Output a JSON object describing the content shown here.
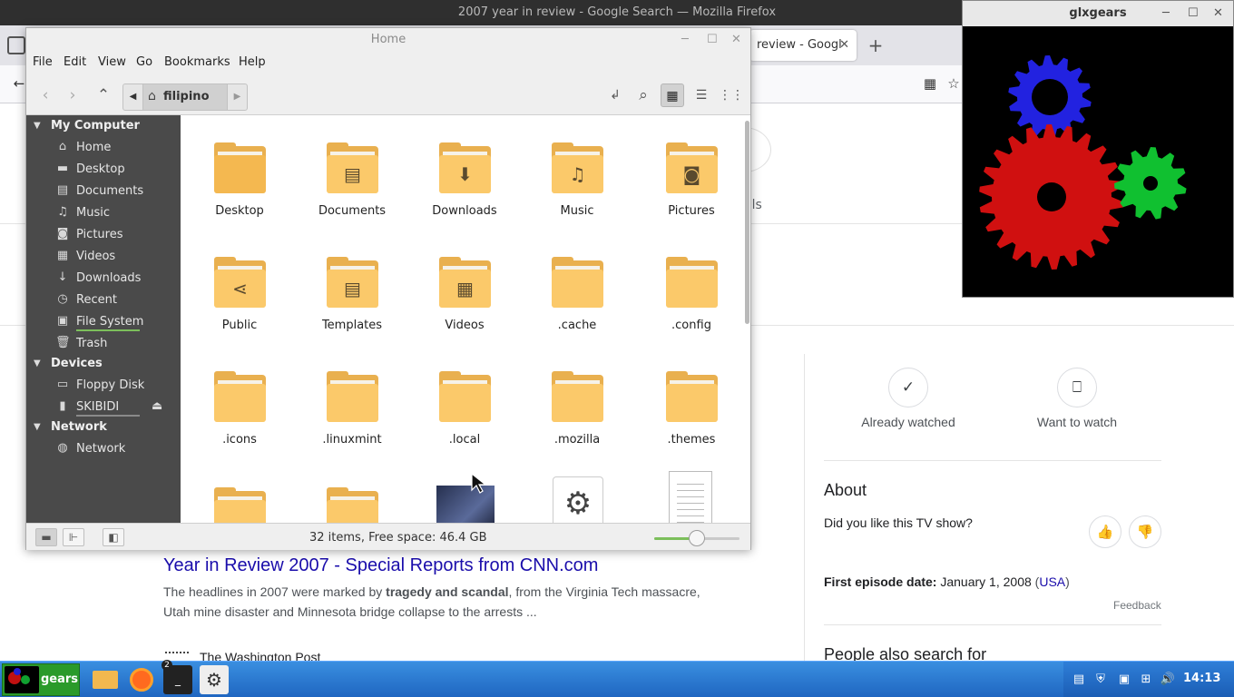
{
  "firefox": {
    "title": "2007 year in review - Google Search — Mozilla Firefox",
    "tab_label": "review - Googl",
    "tab_close": "✕",
    "new_tab": "+",
    "tools_fragment": "ols"
  },
  "google": {
    "result": {
      "title": "Year in Review 2007 - Special Reports from CNN.com",
      "snippet_prefix": "The headlines in 2007 were marked by ",
      "snippet_bold": "tragedy and scandal",
      "snippet_suffix": ", from the Virginia Tech massacre, Utah mine disaster and Minnesota bridge collapse to the arrests ...",
      "next_source": "The Washington Post"
    },
    "knowledge_panel": {
      "already_watched": "Already watched",
      "want_to_watch": "Want to watch",
      "about": "About",
      "question": "Did you like this TV show?",
      "first_episode_label": "First episode date:",
      "first_episode_value": "January 1, 2008",
      "country_link": "USA",
      "feedback": "Feedback",
      "people_also": "People also search for"
    }
  },
  "glxgears": {
    "title": "glxgears",
    "gear_colors": [
      "#2222e0",
      "#d01010",
      "#10c030"
    ]
  },
  "nemo": {
    "title": "Home",
    "menu": [
      "File",
      "Edit",
      "Go",
      "Bookmarks",
      "Help"
    ],
    "menu_view": "View",
    "path_segment": "filipino",
    "sidebar": {
      "my_computer": "My Computer",
      "places": [
        {
          "label": "Home",
          "icon": "home-icon"
        },
        {
          "label": "Desktop",
          "icon": "desktop-icon"
        },
        {
          "label": "Documents",
          "icon": "document-icon"
        },
        {
          "label": "Music",
          "icon": "music-icon"
        },
        {
          "label": "Pictures",
          "icon": "camera-icon"
        },
        {
          "label": "Videos",
          "icon": "film-icon"
        },
        {
          "label": "Downloads",
          "icon": "download-icon"
        },
        {
          "label": "Recent",
          "icon": "clock-icon"
        },
        {
          "label": "File System",
          "icon": "drive-icon"
        },
        {
          "label": "Trash",
          "icon": "trash-icon"
        }
      ],
      "devices": "Devices",
      "floppy": "Floppy Disk",
      "usb": "SKIBIDI",
      "network_head": "Network",
      "network_item": "Network"
    },
    "files": [
      "Desktop",
      "Documents",
      "Downloads",
      "Music",
      "Pictures",
      "Public",
      "Templates",
      "Videos",
      ".cache",
      ".config",
      ".icons",
      ".linuxmint",
      ".local",
      ".mozilla",
      ".themes"
    ],
    "status": "32 items, Free space: 46.4 GB",
    "zoom_level": 0.5
  },
  "taskbar": {
    "gears_label": "gears",
    "terminal_badge": "2",
    "clock": "14:13"
  }
}
